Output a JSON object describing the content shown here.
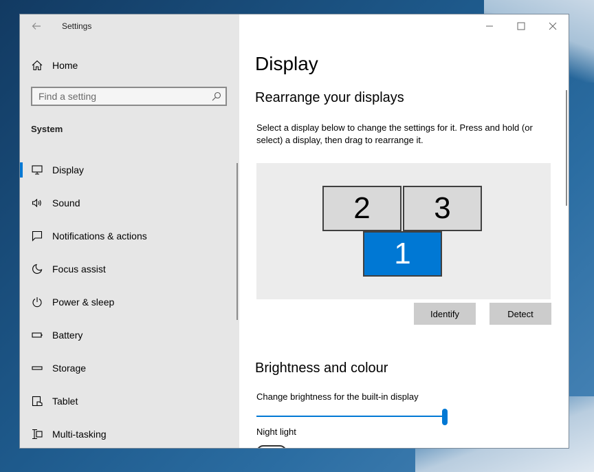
{
  "window": {
    "app_title": "Settings"
  },
  "sidebar": {
    "home_label": "Home",
    "search_placeholder": "Find a setting",
    "section_title": "System",
    "items": [
      {
        "label": "Display",
        "icon": "monitor-icon",
        "active": true
      },
      {
        "label": "Sound",
        "icon": "speaker-icon"
      },
      {
        "label": "Notifications & actions",
        "icon": "notification-icon"
      },
      {
        "label": "Focus assist",
        "icon": "moon-icon"
      },
      {
        "label": "Power & sleep",
        "icon": "power-icon"
      },
      {
        "label": "Battery",
        "icon": "battery-icon"
      },
      {
        "label": "Storage",
        "icon": "storage-icon"
      },
      {
        "label": "Tablet",
        "icon": "tablet-icon"
      },
      {
        "label": "Multi-tasking",
        "icon": "multitasking-icon"
      }
    ]
  },
  "main": {
    "page_title": "Display",
    "rearrange": {
      "heading": "Rearrange your displays",
      "description": "Select a display below to change the settings for it. Press and hold (or select) a display, then drag to rearrange it.",
      "monitors": [
        {
          "number": "2",
          "selected": false
        },
        {
          "number": "3",
          "selected": false
        },
        {
          "number": "1",
          "selected": true
        }
      ],
      "identify_label": "Identify",
      "detect_label": "Detect"
    },
    "brightness": {
      "heading": "Brightness and colour",
      "slider_label": "Change brightness for the built-in display",
      "brightness_value": 100,
      "night_light_label": "Night light"
    }
  },
  "colors": {
    "accent": "#0078d4",
    "sidebar_bg": "#e6e6e6"
  }
}
